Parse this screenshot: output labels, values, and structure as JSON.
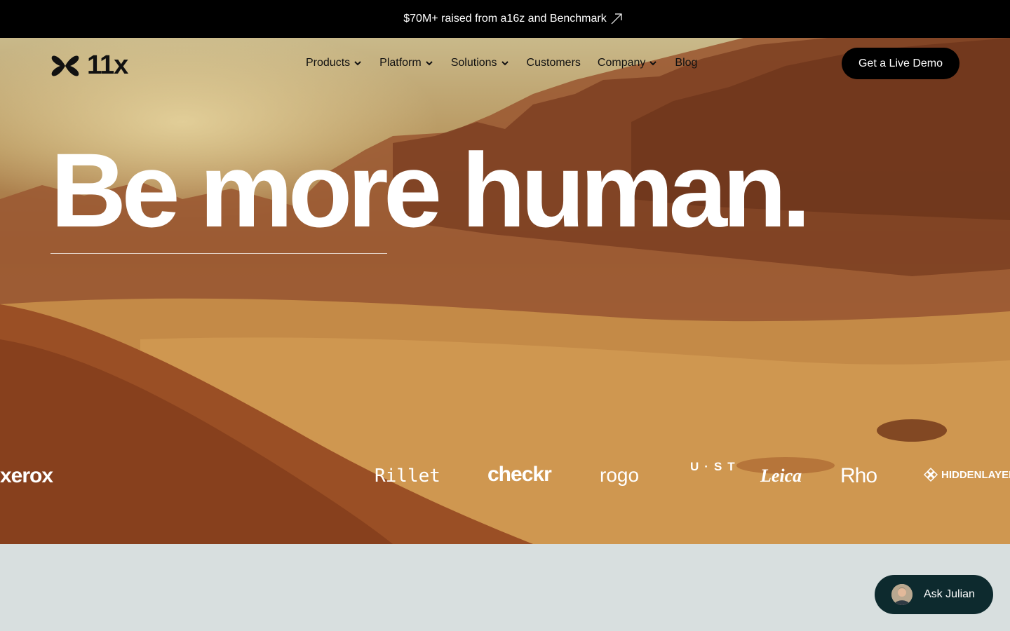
{
  "announcement": {
    "text": "$70M+ raised from a16z and Benchmark"
  },
  "brand": {
    "name": "11x"
  },
  "nav": {
    "items": [
      {
        "label": "Products",
        "has_dropdown": true
      },
      {
        "label": "Platform",
        "has_dropdown": true
      },
      {
        "label": "Solutions",
        "has_dropdown": true
      },
      {
        "label": "Customers",
        "has_dropdown": false
      },
      {
        "label": "Company",
        "has_dropdown": true
      },
      {
        "label": "Blog",
        "has_dropdown": false
      }
    ],
    "cta": "Get a Live Demo"
  },
  "hero": {
    "headline": "Be more human."
  },
  "customer_logos": [
    {
      "name": "xerox"
    },
    {
      "name": "Rillet"
    },
    {
      "name": "checkr"
    },
    {
      "name": "rogo"
    },
    {
      "name": "U·ST"
    },
    {
      "name": "Leica"
    },
    {
      "name": "Rho"
    },
    {
      "name": "HIDDENLAYER"
    }
  ],
  "chat_widget": {
    "label": "Ask Julian"
  },
  "colors": {
    "announcement_bg": "#000000",
    "cta_bg": "#000000",
    "chat_bg": "#0d2a2e",
    "below_fold_bg": "#d8dfdf"
  }
}
